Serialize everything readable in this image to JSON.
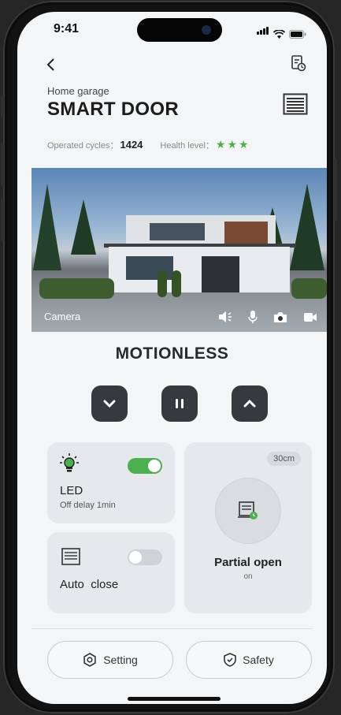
{
  "status": {
    "time": "9:41"
  },
  "header": {
    "subtitle": "Home garage",
    "title": "SMART DOOR",
    "cycles_label": "Operated cycles：",
    "cycles_value": "1424",
    "health_label": "Health level：",
    "health_stars": 3
  },
  "camera": {
    "label": "Camera",
    "controls": [
      "volume-icon",
      "microphone-icon",
      "snapshot-icon",
      "record-icon"
    ]
  },
  "state": "MOTIONLESS",
  "controls": [
    "down-button",
    "pause-button",
    "up-button"
  ],
  "led": {
    "label": "LED",
    "sub": "Off delay 1min",
    "enabled": true
  },
  "auto_close": {
    "label": "Auto  close",
    "enabled": false
  },
  "partial": {
    "chip": "30cm",
    "title": "Partial open",
    "sub": "on"
  },
  "footer": {
    "setting": "Setting",
    "safety": "Safety"
  },
  "colors": {
    "accent_green": "#4caf50",
    "dark_button": "#363a3f",
    "card": "#e6e8ec"
  }
}
